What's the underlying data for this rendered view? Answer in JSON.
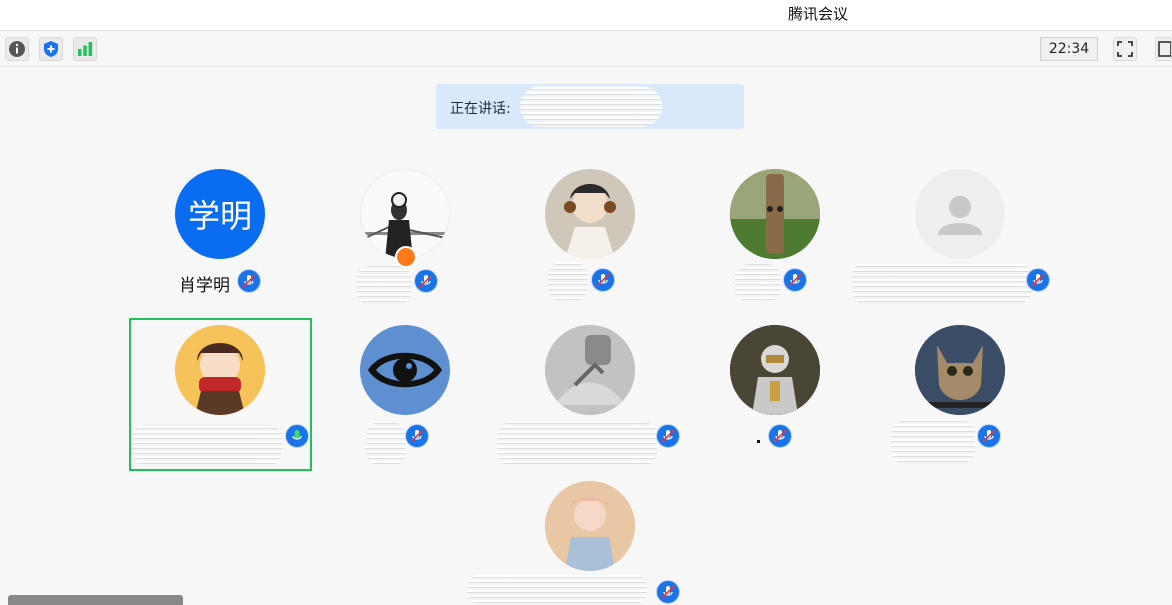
{
  "app": {
    "title": "腾讯会议",
    "time": "22:34"
  },
  "colors": {
    "accent": "#1a73e8",
    "active_speaker_border": "#1fc25a",
    "speaking_banner": "#d9e8fb"
  },
  "toolbar": {
    "left_icons": [
      "info-icon",
      "shield-icon",
      "signal-icon"
    ],
    "right_icons": [
      "fullscreen-icon",
      "layout-icon"
    ]
  },
  "speaking": {
    "label": "正在讲话:"
  },
  "participants": [
    {
      "id": 1,
      "avatar_text": "学明",
      "name": "肖学明",
      "mic": "muted"
    },
    {
      "id": 2,
      "badge_icon": "host-icon",
      "mic": "muted"
    },
    {
      "id": 3,
      "mic": "muted"
    },
    {
      "id": 4,
      "mic": "muted"
    },
    {
      "id": 5,
      "avatar_icon": "default-user-icon",
      "mic": "muted"
    },
    {
      "id": 6,
      "mic": "active",
      "selected": true
    },
    {
      "id": 7,
      "avatar_icon": "eye-icon",
      "mic": "muted"
    },
    {
      "id": 8,
      "mic": "muted"
    },
    {
      "id": 9,
      "mic": "muted"
    },
    {
      "id": 10,
      "mic": "muted"
    },
    {
      "id": 11,
      "mic": "muted"
    }
  ]
}
